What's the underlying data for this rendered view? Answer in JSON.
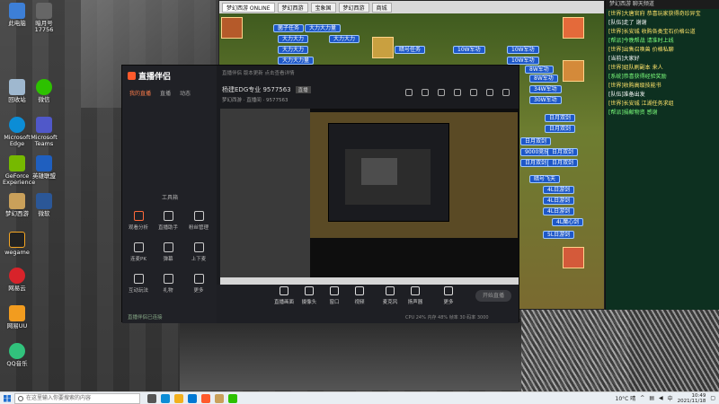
{
  "desktop": {
    "icons": [
      {
        "label": "此电脑"
      },
      {
        "label": "暗月号\n17756"
      },
      {
        "label": "回收站"
      },
      {
        "label": "微信"
      },
      {
        "label": "Microsoft Edge"
      },
      {
        "label": "Microsoft Teams"
      },
      {
        "label": "GeForce Experience"
      },
      {
        "label": "英雄联盟"
      },
      {
        "label": "梦幻西游"
      },
      {
        "label": "微软"
      },
      {
        "label": "wegame"
      },
      {
        "label": "网易云"
      },
      {
        "label": "网易UU"
      },
      {
        "label": "QQ音乐"
      }
    ]
  },
  "game_window": {
    "tabs": [
      "梦幻西游 ONLINE",
      "梦幻西游",
      "宝象国",
      "梦幻西游",
      "商城"
    ],
    "chips": [
      "菌子任务",
      "大力大力量",
      "大力大力",
      "大力大力",
      "大力大力",
      "大力大力量",
      "暗号任务",
      "10W军功",
      "10W军功",
      "10W军功",
      "8W军功",
      "8W军功",
      "34W军功",
      "30W军功",
      "日月双剑",
      "日月双剑",
      "日月双剑",
      "9000竞技",
      "日月双剑",
      "日月双剑",
      "日月双剑",
      "暗号飞天",
      "4L日游剑",
      "4L日游剑",
      "4L日游剑",
      "4L魔心剑",
      "5L日游剑"
    ]
  },
  "chat": {
    "header": "梦幻西游 聊天频道",
    "lines": [
      {
        "text": "[世界]大唐官府 恭喜玩家获得奇珍异宝",
        "color": "y"
      },
      {
        "text": "[队伍]走了 谢谢",
        "color": "w"
      },
      {
        "text": "[世界]长安城 收购各类宝石价格公道",
        "color": "y"
      },
      {
        "text": "[帮派]今晚帮战 请准时上线",
        "color": "g"
      },
      {
        "text": "[世界]出售召唤兽 价格私聊",
        "color": "y"
      },
      {
        "text": "[当前]大家好",
        "color": "w"
      },
      {
        "text": "[世界]组队刷副本 来人",
        "color": "y"
      },
      {
        "text": "[系统]恭喜获得经验奖励",
        "color": "g"
      },
      {
        "text": "[世界]收购高级技能书",
        "color": "y"
      },
      {
        "text": "[队伍]准备出发",
        "color": "w"
      },
      {
        "text": "[世界]长安城 江湖任务求组",
        "color": "y"
      },
      {
        "text": "[帮派]捐献物资 感谢",
        "color": "g"
      }
    ]
  },
  "stream_app": {
    "logo": "直播伴侣",
    "tabs": {
      "t1": "我的直播",
      "t2": "直播",
      "t3": "动态"
    },
    "top_notice": "直播伴侣 版本更新 点击查看详情",
    "title": "杨建EDG专业 9577563",
    "badge": "直播",
    "subtitle": "梦幻西游 · 直播间  ·  9577563",
    "tools_label": "工具箱",
    "tools": [
      {
        "label": "观看分析"
      },
      {
        "label": "直播助手"
      },
      {
        "label": "粉丝管理"
      },
      {
        "label": "连麦PK"
      },
      {
        "label": "弹幕"
      },
      {
        "label": "上下麦"
      },
      {
        "label": "互动玩法"
      },
      {
        "label": "礼物"
      },
      {
        "label": "更多"
      }
    ],
    "status": "直播伴侣已连接",
    "bottom_tools": [
      {
        "label": "直播画面"
      },
      {
        "label": "摄像头"
      },
      {
        "label": "窗口"
      },
      {
        "label": "视频"
      },
      {
        "label": "麦克风"
      },
      {
        "label": "扬声器"
      },
      {
        "label": "更多"
      }
    ],
    "start_live": "开始直播",
    "stats": "CPU 24%  内存 48%  帧率 30  码率 3000"
  },
  "taskbar": {
    "search_placeholder": "在这里输入你要搜索的内容",
    "weather": "10°C 晴",
    "lang": "中",
    "time": "10:49",
    "date": "2021/11/18"
  },
  "colors": {
    "accent": "#ff5a2c",
    "chip_blue": "#1e58c8",
    "chat_yellow": "#ffe46a",
    "chat_green": "#7cff7c"
  }
}
